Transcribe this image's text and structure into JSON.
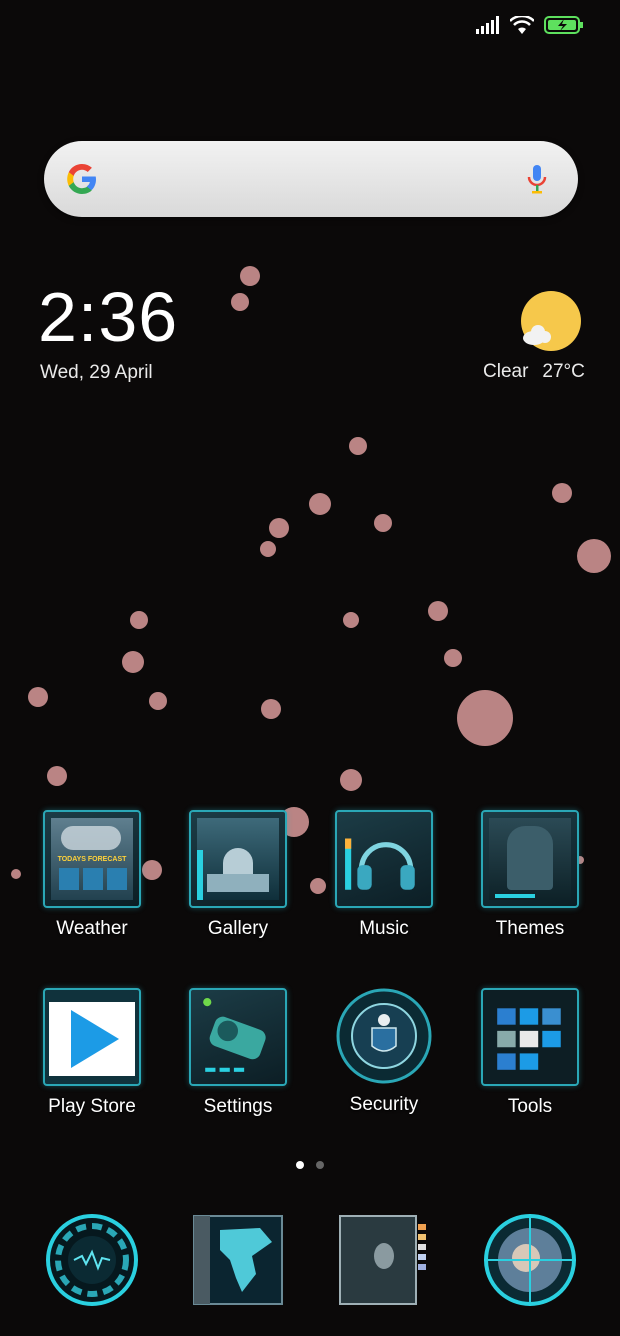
{
  "status_bar": {
    "icons": [
      "signal-icon",
      "wifi-icon",
      "battery-charging-icon"
    ]
  },
  "search": {
    "logo": "google-logo",
    "mic_icon": "mic-icon"
  },
  "clock": {
    "time": "2:36",
    "date": "Wed, 29 April"
  },
  "weather": {
    "condition": "Clear",
    "temperature": "27°C",
    "icon": "sun-cloud-icon"
  },
  "apps": [
    {
      "label": "Weather",
      "icon": "weather-app-icon"
    },
    {
      "label": "Gallery",
      "icon": "gallery-app-icon"
    },
    {
      "label": "Music",
      "icon": "headphones-icon"
    },
    {
      "label": "Themes",
      "icon": "themes-app-icon"
    },
    {
      "label": "Play Store",
      "icon": "play-store-icon"
    },
    {
      "label": "Settings",
      "icon": "gear-icon"
    },
    {
      "label": "Security",
      "icon": "security-seal-icon"
    },
    {
      "label": "Tools",
      "icon": "tools-folder-icon"
    }
  ],
  "weather_tile_text": "TODAYS FORECAST",
  "pager": {
    "pages": 2,
    "current": 1
  },
  "dock": [
    {
      "icon": "phone-ring-icon"
    },
    {
      "icon": "map-icon"
    },
    {
      "icon": "messages-icon"
    },
    {
      "icon": "camera-target-icon"
    }
  ],
  "colors": {
    "background": "#0b0909",
    "accent": "#2aa7b6",
    "bubble": "#d99a9a",
    "sun": "#f6c84b"
  }
}
